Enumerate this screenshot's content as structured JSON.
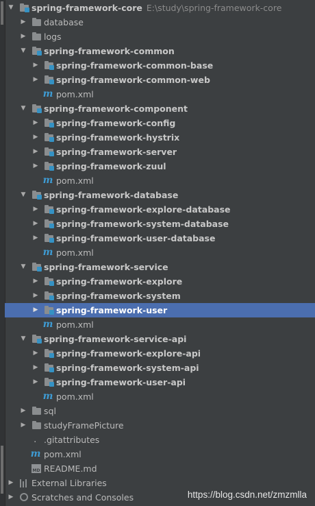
{
  "tree": {
    "root": {
      "label": "spring-framework-core",
      "path": "E:\\study\\spring-framework-core"
    },
    "database": "database",
    "logs": "logs",
    "common": {
      "label": "spring-framework-common",
      "children": [
        "spring-framework-common-base",
        "spring-framework-common-web"
      ],
      "pom": "pom.xml"
    },
    "component": {
      "label": "spring-framework-component",
      "children": [
        "spring-framework-config",
        "spring-framework-hystrix",
        "spring-framework-server",
        "spring-framework-zuul"
      ],
      "pom": "pom.xml"
    },
    "dbmodule": {
      "label": "spring-framework-database",
      "children": [
        "spring-framework-explore-database",
        "spring-framework-system-database",
        "spring-framework-user-database"
      ],
      "pom": "pom.xml"
    },
    "service": {
      "label": "spring-framework-service",
      "children": [
        "spring-framework-explore",
        "spring-framework-system",
        "spring-framework-user"
      ],
      "pom": "pom.xml"
    },
    "serviceapi": {
      "label": "spring-framework-service-api",
      "children": [
        "spring-framework-explore-api",
        "spring-framework-system-api",
        "spring-framework-user-api"
      ],
      "pom": "pom.xml"
    },
    "sql": "sql",
    "studyFramePicture": "studyFramePicture",
    "gitattributes": ".gitattributes",
    "pom": "pom.xml",
    "readme": "README.md",
    "external": "External Libraries",
    "scratches": "Scratches and Consoles",
    "selected": "spring-framework-user"
  },
  "watermark": "https://blog.csdn.net/zmzmlla",
  "colors": {
    "background": "#3c3f41",
    "selection": "#4b6eaf",
    "module_icon": "#3592c4",
    "maven_icon": "#3e9bd3"
  }
}
